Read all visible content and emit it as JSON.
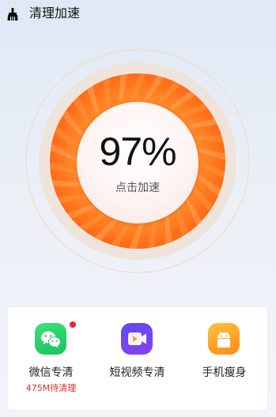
{
  "header": {
    "icon": "broom-icon",
    "title": "清理加速"
  },
  "dial": {
    "percent_text": "97%",
    "action_label": "点击加速",
    "colors": {
      "ring_orange": "#ff7a1f",
      "ring_light": "#ffa24a",
      "outer_track": "#efe5dc"
    }
  },
  "tools": [
    {
      "label": "微信专清",
      "sub": "475M待清理",
      "icon": "wechat-icon",
      "badge": true
    },
    {
      "label": "短视频专清",
      "sub": "",
      "icon": "video-icon",
      "badge": false
    },
    {
      "label": "手机瘦身",
      "sub": "",
      "icon": "android-icon",
      "badge": false
    }
  ]
}
